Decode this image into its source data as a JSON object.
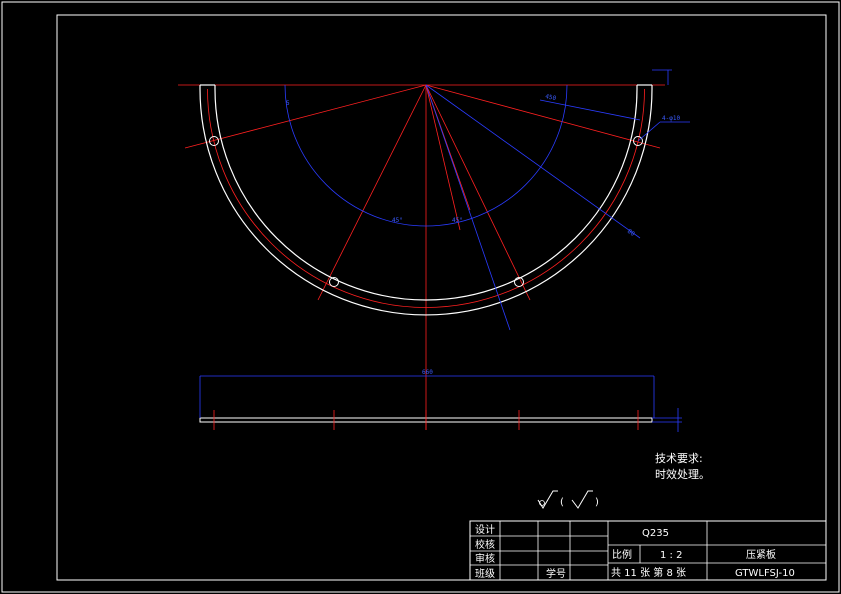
{
  "colors": {
    "background": "#000000",
    "outline": "#ffffff",
    "centerline": "#ff2020",
    "dimension": "#2a3cff"
  },
  "notes": {
    "line1": "技术要求:",
    "line2": "时效处理。"
  },
  "roughness": {
    "symbol": "√",
    "paren_open": "(",
    "paren_symbol": "√",
    "paren_close": ")"
  },
  "title_block": {
    "designed": "设计",
    "checked": "校核",
    "reviewed": "审核",
    "class": "班级",
    "student_no": "学号",
    "material": "Q235",
    "scale_label": "比例",
    "scale_value": "1 : 2",
    "sheets": "共 11 张 第 8 张",
    "part_name": "压紧板",
    "drawing_no": "GTWLFSJ-10"
  },
  "dimensions": {
    "hole_spec": "4-φ10",
    "d1": "450",
    "d2": "80",
    "width": "660",
    "a1": "45°",
    "a2": "45°",
    "a3": "5"
  }
}
